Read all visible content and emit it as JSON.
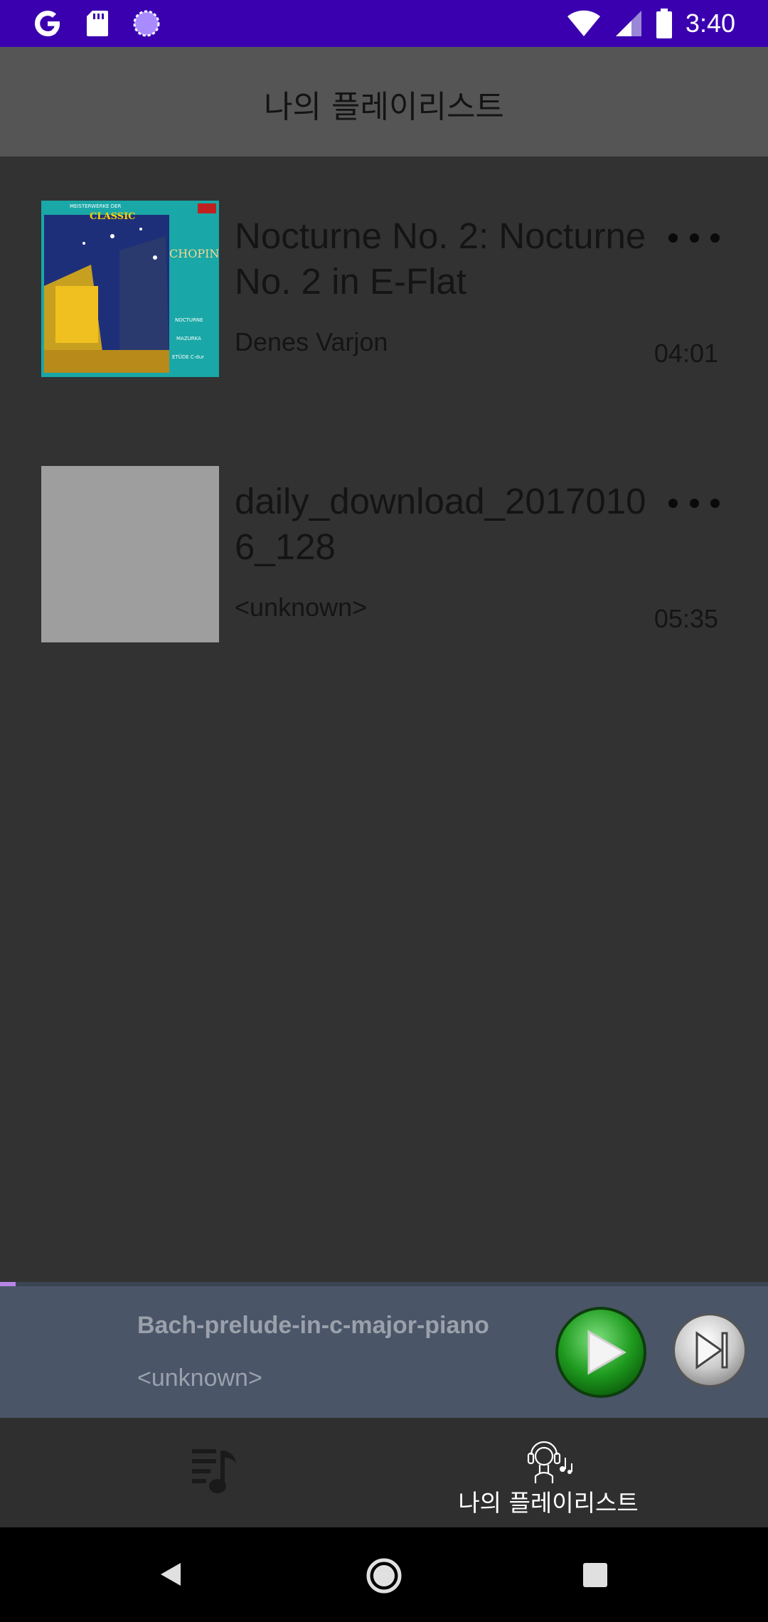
{
  "status_bar": {
    "left_icons": [
      "google-icon",
      "sd-card-icon",
      "sync-circle-icon"
    ],
    "right_icons": [
      "wifi-icon",
      "signal-icon",
      "battery-icon"
    ],
    "time": "3:40",
    "background": "#3a00b0"
  },
  "app_bar": {
    "title": "나의 플레이리스트"
  },
  "playlist": {
    "tracks": [
      {
        "title": "Nocturne No. 2: Nocturne No. 2 in E-Flat",
        "artist": "Denes Varjon",
        "duration": "04:01",
        "has_artwork": true,
        "artwork_text": {
          "top": "MEISTERWERKE DER",
          "series": "CLASSIC",
          "composer": "CHOPIN",
          "line1": "NOCTURNE",
          "line2": "MAZURKA",
          "line3": "ETÜDE C-dur"
        }
      },
      {
        "title": "daily_download_20170106_128",
        "artist": "<unknown>",
        "duration": "05:35",
        "has_artwork": false
      }
    ]
  },
  "mini_player": {
    "title": "Bach-prelude-in-c-major-piano",
    "artist": "<unknown>",
    "progress": 0.02,
    "accent": "#b784e6"
  },
  "bottom_nav": {
    "items": [
      {
        "icon": "playlist-music-icon",
        "label": ""
      },
      {
        "icon": "listener-headphones-icon",
        "label": "나의 플레이리스트",
        "active": true
      }
    ]
  },
  "system_nav": {
    "buttons": [
      "back",
      "home",
      "recents"
    ]
  }
}
